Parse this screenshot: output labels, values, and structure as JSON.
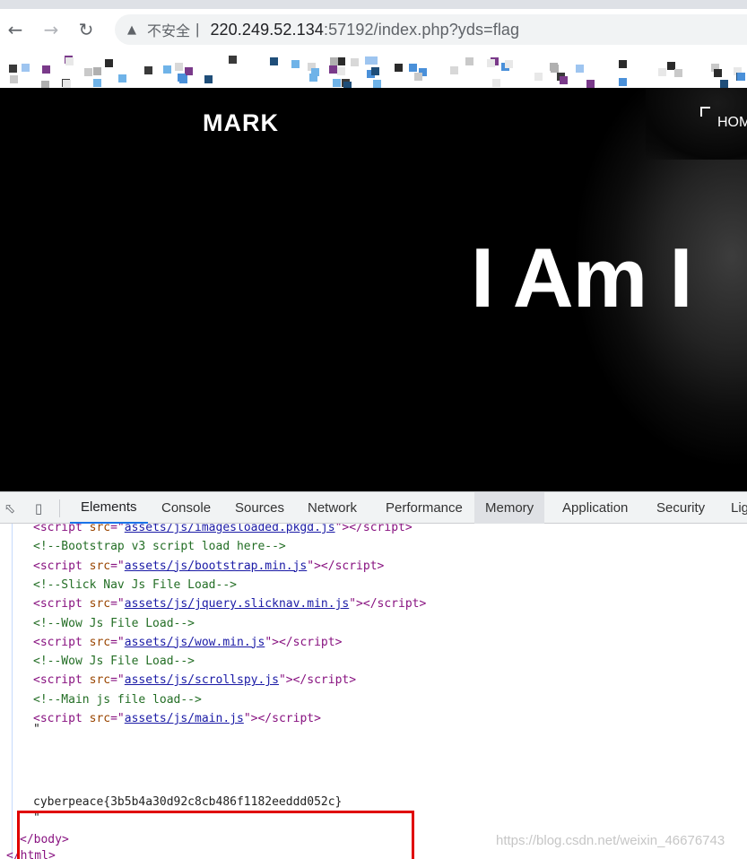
{
  "browser": {
    "security_label": "不安全",
    "separator": "|",
    "url_host": "220.249.52.134",
    "url_rest": ":57192/index.php?yds=flag",
    "back_icon": "back-arrow-icon",
    "forward_icon": "forward-arrow-icon",
    "reload_icon": "reload-icon"
  },
  "page": {
    "logo": "MARK",
    "nav_item": "HOM",
    "hero_text": "I Am I"
  },
  "devtools": {
    "tabs": [
      "Elements",
      "Console",
      "Sources",
      "Network",
      "Performance",
      "Memory",
      "Application",
      "Security",
      "Lig"
    ],
    "active_tab": "Elements",
    "lines": [
      {
        "kind": "script",
        "src": "assets/js/imagesloaded.pkgd.js"
      },
      {
        "kind": "comment",
        "text": "<!--Bootstrap v3 script load here-->"
      },
      {
        "kind": "script",
        "src": "assets/js/bootstrap.min.js"
      },
      {
        "kind": "comment",
        "text": "<!--Slick Nav Js File Load-->"
      },
      {
        "kind": "script",
        "src": "assets/js/jquery.slicknav.min.js"
      },
      {
        "kind": "comment",
        "text": "<!--Wow Js File Load-->"
      },
      {
        "kind": "script",
        "src": "assets/js/wow.min.js"
      },
      {
        "kind": "comment",
        "text": "<!--Wow Js File Load-->"
      },
      {
        "kind": "script",
        "src": "assets/js/scrollspy.js"
      },
      {
        "kind": "comment",
        "text": "<!--Main js file load-->"
      },
      {
        "kind": "script",
        "src": "assets/js/main.js"
      }
    ],
    "text_quote": "\"",
    "flag": "cyberpeace{3b5b4a30d92c8cb486f1182eeddd052c}",
    "flag_quote": "\"",
    "close_body": "</body>",
    "close_html": "</html>"
  },
  "watermark": "https://blog.csdn.net/weixin_46676743"
}
